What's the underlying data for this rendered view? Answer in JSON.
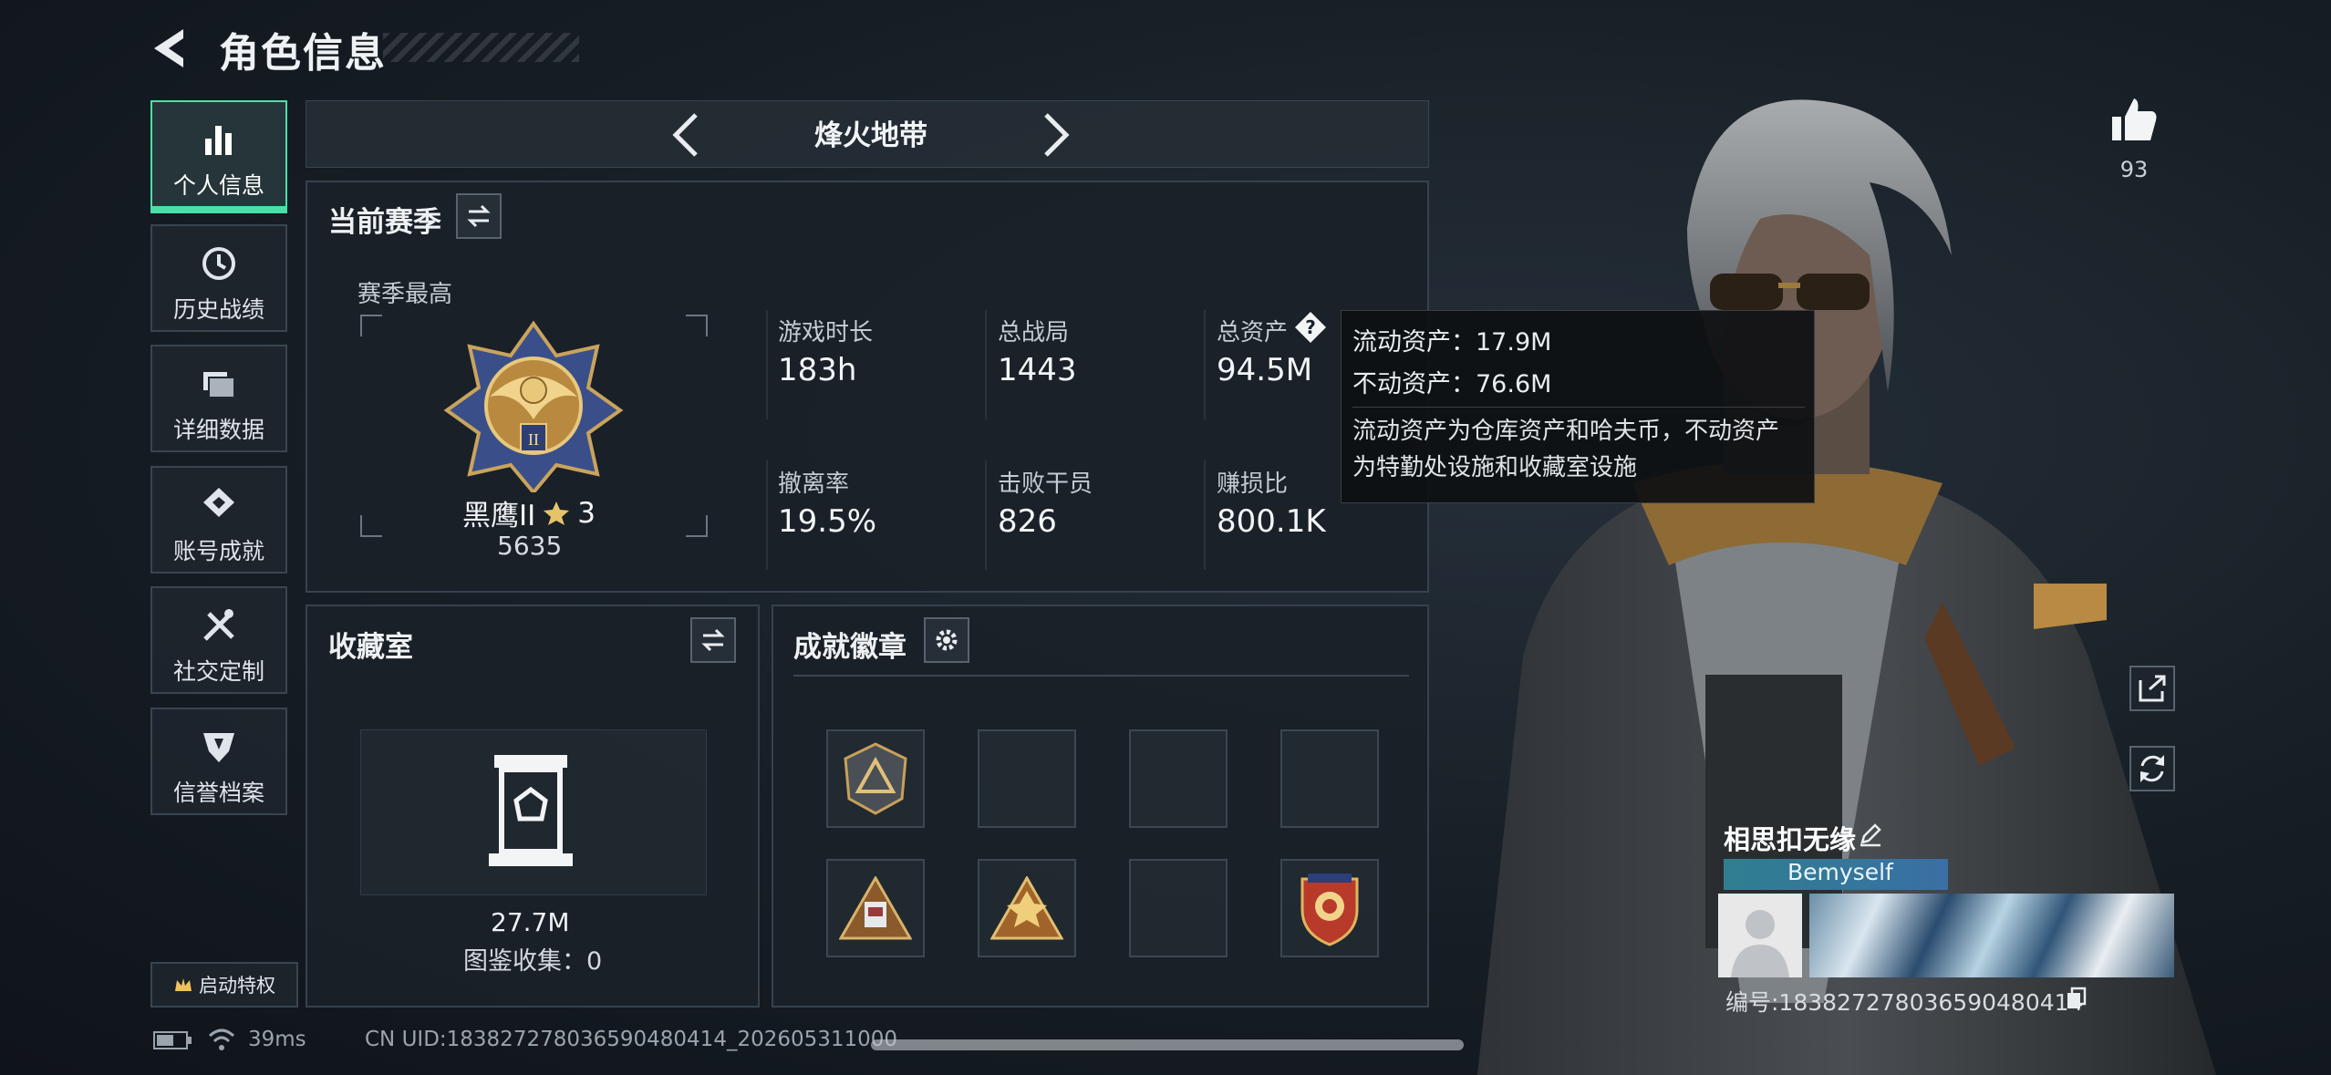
{
  "header": {
    "title": "角色信息"
  },
  "nav": {
    "items": [
      {
        "label": "个人信息",
        "icon": "bar-chart-icon",
        "active": true
      },
      {
        "label": "历史战绩",
        "icon": "clock-history-icon"
      },
      {
        "label": "详细数据",
        "icon": "folder-icon"
      },
      {
        "label": "账号成就",
        "icon": "achievement-icon"
      },
      {
        "label": "社交定制",
        "icon": "tools-icon"
      },
      {
        "label": "信誉档案",
        "icon": "shield-icon"
      }
    ],
    "privilege_label": "启动特权"
  },
  "mode": {
    "title": "烽火地带"
  },
  "season": {
    "title": "当前赛季",
    "subtitle": "赛季最高",
    "rank_name": "黑鹰II",
    "rank_stars": "3",
    "rank_score": "5635",
    "stats": [
      {
        "label": "游戏时长",
        "value": "183h"
      },
      {
        "label": "总战局",
        "value": "1443"
      },
      {
        "label": "总资产",
        "value": "94.5M"
      },
      {
        "label": "撤离率",
        "value": "19.5%"
      },
      {
        "label": "击败干员",
        "value": "826"
      },
      {
        "label": "赚损比",
        "value": "800.1K"
      }
    ]
  },
  "collection": {
    "title": "收藏室",
    "value": "27.7M",
    "catalog_label": "图鉴收集：0"
  },
  "badges": {
    "title": "成就徽章"
  },
  "tooltip": {
    "liquid": "流动资产：17.9M",
    "fixed": "不动资产：76.6M",
    "desc": "流动资产为仓库资产和哈夫币，不动资产为特勤处设施和收藏室设施"
  },
  "profile": {
    "likes": "93",
    "name": "相思扣无缘",
    "nameplate": "Bemyself",
    "id": "编号:1838272780365904804​14"
  },
  "status": {
    "ping": "39ms",
    "uid": "CN UID:183827278036590480414_202605311000"
  },
  "colors": {
    "accent": "#49e0a8",
    "panel": "#1a2128",
    "border": "#36424d"
  }
}
